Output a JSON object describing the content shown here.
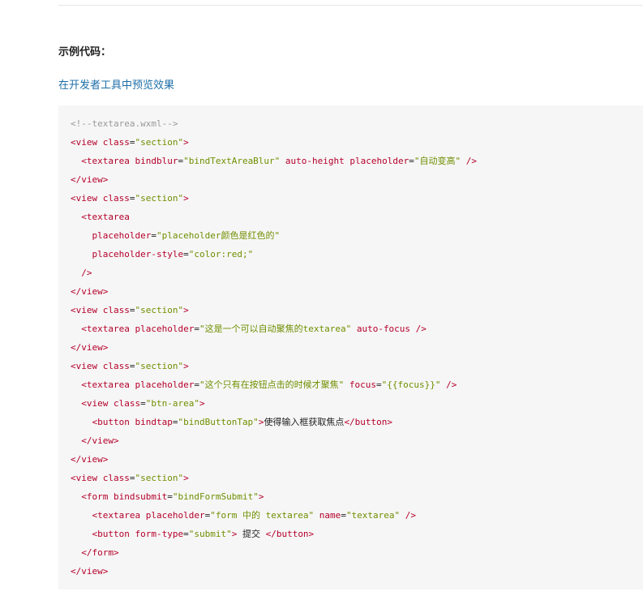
{
  "heading": "示例代码：",
  "preview_link": "在开发者工具中预览效果",
  "colors": {
    "tag": "#b5002a",
    "string": "#6f8f00",
    "text": "#222222",
    "comment": "#999999",
    "link": "#1f6fa8",
    "code_background": "#f6f6f6"
  },
  "code_lines": [
    [
      {
        "t": "comment",
        "v": "<!--textarea.wxml-->"
      }
    ],
    [
      {
        "t": "tag",
        "v": "<view "
      },
      {
        "t": "attr",
        "v": "class"
      },
      {
        "t": "punct",
        "v": "="
      },
      {
        "t": "str",
        "v": "\"section\""
      },
      {
        "t": "tag",
        "v": ">"
      }
    ],
    [
      {
        "t": "text",
        "v": "  "
      },
      {
        "t": "tag",
        "v": "<textarea "
      },
      {
        "t": "attr",
        "v": "bindblur"
      },
      {
        "t": "punct",
        "v": "="
      },
      {
        "t": "str",
        "v": "\"bindTextAreaBlur\""
      },
      {
        "t": "attr",
        "v": " auto-height placeholder"
      },
      {
        "t": "punct",
        "v": "="
      },
      {
        "t": "str",
        "v": "\"自动变高\""
      },
      {
        "t": "tag",
        "v": " />"
      }
    ],
    [
      {
        "t": "tag",
        "v": "</view>"
      }
    ],
    [
      {
        "t": "tag",
        "v": "<view "
      },
      {
        "t": "attr",
        "v": "class"
      },
      {
        "t": "punct",
        "v": "="
      },
      {
        "t": "str",
        "v": "\"section\""
      },
      {
        "t": "tag",
        "v": ">"
      }
    ],
    [
      {
        "t": "text",
        "v": "  "
      },
      {
        "t": "tag",
        "v": "<textarea"
      }
    ],
    [
      {
        "t": "text",
        "v": "    "
      },
      {
        "t": "attr",
        "v": "placeholder"
      },
      {
        "t": "punct",
        "v": "="
      },
      {
        "t": "str",
        "v": "\"placeholder颜色是红色的\""
      }
    ],
    [
      {
        "t": "text",
        "v": "    "
      },
      {
        "t": "attr",
        "v": "placeholder-style"
      },
      {
        "t": "punct",
        "v": "="
      },
      {
        "t": "str",
        "v": "\"color:red;\""
      }
    ],
    [
      {
        "t": "text",
        "v": "  "
      },
      {
        "t": "tag",
        "v": "/>"
      }
    ],
    [
      {
        "t": "tag",
        "v": "</view>"
      }
    ],
    [
      {
        "t": "tag",
        "v": "<view "
      },
      {
        "t": "attr",
        "v": "class"
      },
      {
        "t": "punct",
        "v": "="
      },
      {
        "t": "str",
        "v": "\"section\""
      },
      {
        "t": "tag",
        "v": ">"
      }
    ],
    [
      {
        "t": "text",
        "v": "  "
      },
      {
        "t": "tag",
        "v": "<textarea "
      },
      {
        "t": "attr",
        "v": "placeholder"
      },
      {
        "t": "punct",
        "v": "="
      },
      {
        "t": "str",
        "v": "\"这是一个可以自动聚焦的textarea\""
      },
      {
        "t": "attr",
        "v": " auto-focus"
      },
      {
        "t": "tag",
        "v": " />"
      }
    ],
    [
      {
        "t": "tag",
        "v": "</view>"
      }
    ],
    [
      {
        "t": "tag",
        "v": "<view "
      },
      {
        "t": "attr",
        "v": "class"
      },
      {
        "t": "punct",
        "v": "="
      },
      {
        "t": "str",
        "v": "\"section\""
      },
      {
        "t": "tag",
        "v": ">"
      }
    ],
    [
      {
        "t": "text",
        "v": "  "
      },
      {
        "t": "tag",
        "v": "<textarea "
      },
      {
        "t": "attr",
        "v": "placeholder"
      },
      {
        "t": "punct",
        "v": "="
      },
      {
        "t": "str",
        "v": "\"这个只有在按钮点击的时候才聚焦\""
      },
      {
        "t": "attr",
        "v": " focus"
      },
      {
        "t": "punct",
        "v": "="
      },
      {
        "t": "str",
        "v": "\"{{focus}}\""
      },
      {
        "t": "tag",
        "v": " />"
      }
    ],
    [
      {
        "t": "text",
        "v": "  "
      },
      {
        "t": "tag",
        "v": "<view "
      },
      {
        "t": "attr",
        "v": "class"
      },
      {
        "t": "punct",
        "v": "="
      },
      {
        "t": "str",
        "v": "\"btn-area\""
      },
      {
        "t": "tag",
        "v": ">"
      }
    ],
    [
      {
        "t": "text",
        "v": "    "
      },
      {
        "t": "tag",
        "v": "<button "
      },
      {
        "t": "attr",
        "v": "bindtap"
      },
      {
        "t": "punct",
        "v": "="
      },
      {
        "t": "str",
        "v": "\"bindButtonTap\""
      },
      {
        "t": "tag",
        "v": ">"
      },
      {
        "t": "text",
        "v": "使得输入框获取焦点"
      },
      {
        "t": "tag",
        "v": "</button>"
      }
    ],
    [
      {
        "t": "text",
        "v": "  "
      },
      {
        "t": "tag",
        "v": "</view>"
      }
    ],
    [
      {
        "t": "tag",
        "v": "</view>"
      }
    ],
    [
      {
        "t": "tag",
        "v": "<view "
      },
      {
        "t": "attr",
        "v": "class"
      },
      {
        "t": "punct",
        "v": "="
      },
      {
        "t": "str",
        "v": "\"section\""
      },
      {
        "t": "tag",
        "v": ">"
      }
    ],
    [
      {
        "t": "text",
        "v": "  "
      },
      {
        "t": "tag",
        "v": "<form "
      },
      {
        "t": "attr",
        "v": "bindsubmit"
      },
      {
        "t": "punct",
        "v": "="
      },
      {
        "t": "str",
        "v": "\"bindFormSubmit\""
      },
      {
        "t": "tag",
        "v": ">"
      }
    ],
    [
      {
        "t": "text",
        "v": "    "
      },
      {
        "t": "tag",
        "v": "<textarea "
      },
      {
        "t": "attr",
        "v": "placeholder"
      },
      {
        "t": "punct",
        "v": "="
      },
      {
        "t": "str",
        "v": "\"form 中的 textarea\""
      },
      {
        "t": "attr",
        "v": " name"
      },
      {
        "t": "punct",
        "v": "="
      },
      {
        "t": "str",
        "v": "\"textarea\""
      },
      {
        "t": "tag",
        "v": " />"
      }
    ],
    [
      {
        "t": "text",
        "v": "    "
      },
      {
        "t": "tag",
        "v": "<button "
      },
      {
        "t": "attr",
        "v": "form-type"
      },
      {
        "t": "punct",
        "v": "="
      },
      {
        "t": "str",
        "v": "\"submit\""
      },
      {
        "t": "tag",
        "v": ">"
      },
      {
        "t": "text",
        "v": " 提交 "
      },
      {
        "t": "tag",
        "v": "</button>"
      }
    ],
    [
      {
        "t": "text",
        "v": "  "
      },
      {
        "t": "tag",
        "v": "</form>"
      }
    ],
    [
      {
        "t": "tag",
        "v": "</view>"
      }
    ]
  ]
}
